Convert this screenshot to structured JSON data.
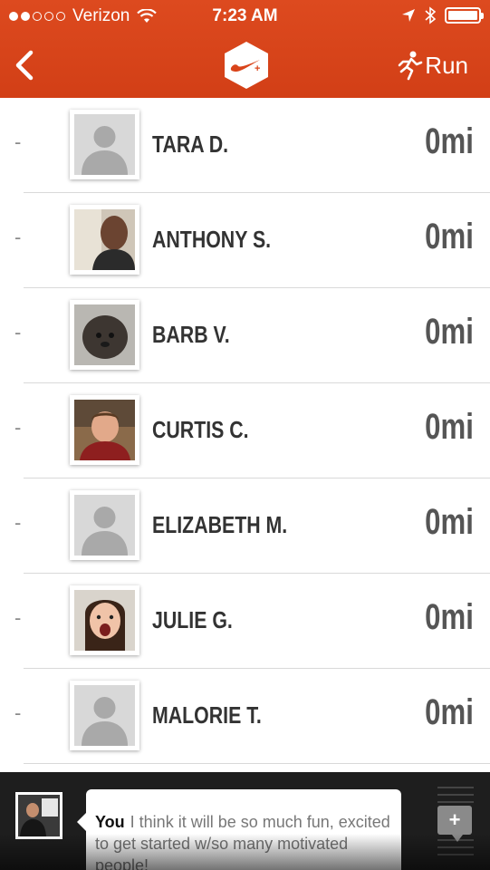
{
  "status_bar": {
    "carrier": "Verizon",
    "time": "7:23 AM",
    "signal_filled": 2,
    "signal_total": 5,
    "battery_level": 1.0
  },
  "header": {
    "back_icon": "chevron-left-icon",
    "logo_icon": "nike-plus-logo",
    "run_label": "Run",
    "run_icon": "runner-icon",
    "accent_color": "#d9441a"
  },
  "leaderboard": [
    {
      "rank": "-",
      "name": "TARA D.",
      "distance": "0mi",
      "avatar": "default"
    },
    {
      "rank": "-",
      "name": "ANTHONY S.",
      "distance": "0mi",
      "avatar": "photo"
    },
    {
      "rank": "-",
      "name": "BARB V.",
      "distance": "0mi",
      "avatar": "photo"
    },
    {
      "rank": "-",
      "name": "CURTIS C.",
      "distance": "0mi",
      "avatar": "photo"
    },
    {
      "rank": "-",
      "name": "ELIZABETH M.",
      "distance": "0mi",
      "avatar": "default"
    },
    {
      "rank": "-",
      "name": "JULIE G.",
      "distance": "0mi",
      "avatar": "photo"
    },
    {
      "rank": "-",
      "name": "MALORIE T.",
      "distance": "0mi",
      "avatar": "default"
    }
  ],
  "comment_bar": {
    "author": "You",
    "message": "I think it will be so much fun, excited to get started w/so many motivated people!",
    "compose_icon": "add-comment-icon"
  }
}
